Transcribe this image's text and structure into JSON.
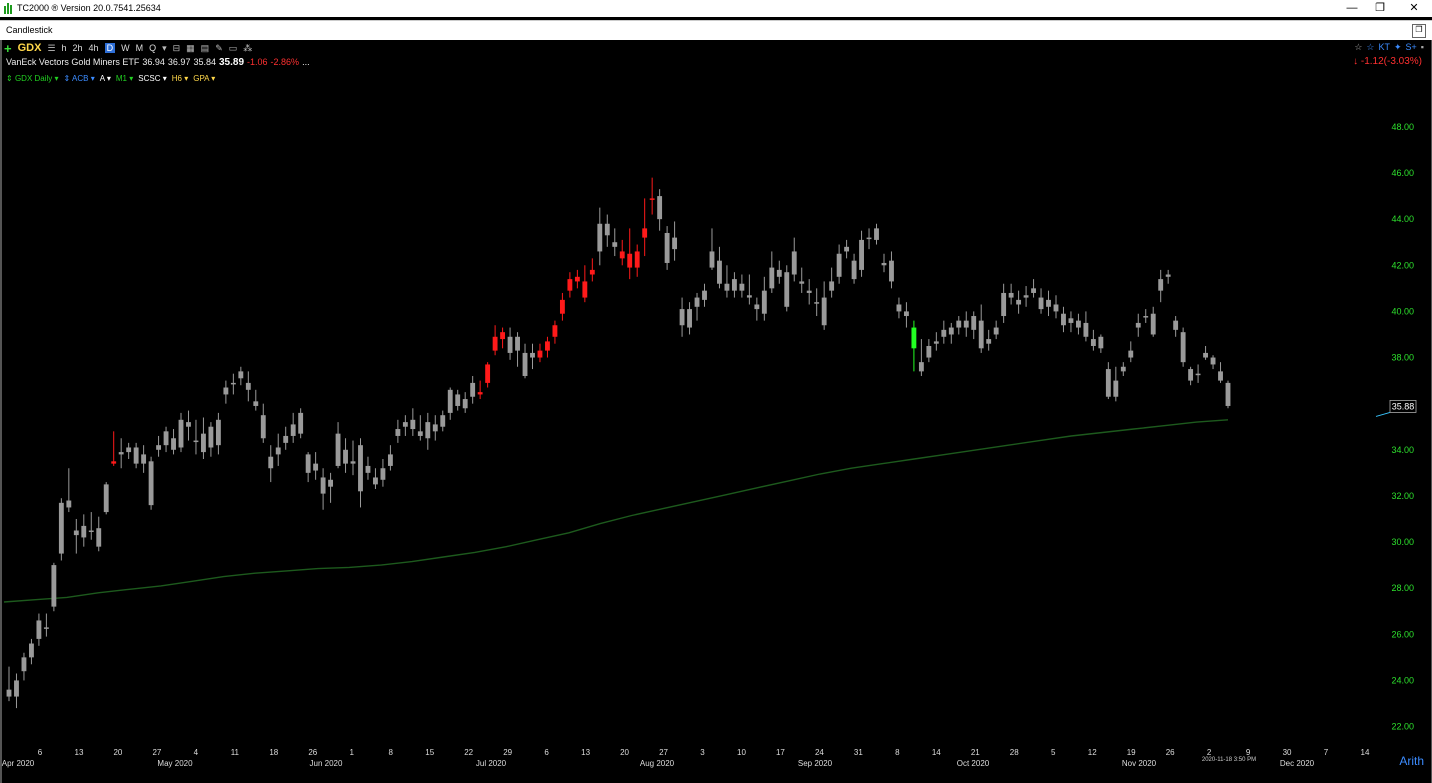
{
  "window": {
    "title": "TC2000 ® Version 20.0.7541.25634",
    "minimize": "—",
    "restore": "❐",
    "close": "✕"
  },
  "chart_window": {
    "title": "Candlestick"
  },
  "toolbar": {
    "symbol": "GDX",
    "timeframes": [
      "h",
      "2h",
      "4h",
      "D",
      "W",
      "M",
      "Q"
    ],
    "active_timeframe": "D"
  },
  "quote": {
    "name": "VanEck Vectors Gold Miners ETF",
    "open": "36.94",
    "high": "36.97",
    "low": "35.84",
    "last": "35.89",
    "change": "-1.06",
    "change_pct": "-2.86%",
    "more": "...",
    "right_change": "-1.12(-3.03%)"
  },
  "indicators": [
    {
      "label": "GDX Daily",
      "color": "#22d022"
    },
    {
      "label": "ACB",
      "color": "#3c8cff"
    },
    {
      "label": "A",
      "color": "#ffffff"
    },
    {
      "label": "M1",
      "color": "#22d022"
    },
    {
      "label": "SCSC",
      "color": "#ffffff"
    },
    {
      "label": "H6",
      "color": "#ffd84a"
    },
    {
      "label": "GPA",
      "color": "#ffd84a"
    }
  ],
  "scale_mode": "Arith",
  "timestamp": "2020-11-18 3:50 PM",
  "chart_data": {
    "type": "candlestick",
    "y_ticks": [
      "48.00",
      "46.00",
      "44.00",
      "42.00",
      "40.00",
      "38.00",
      "36.00",
      "34.00",
      "32.00",
      "30.00",
      "28.00",
      "26.00",
      "24.00",
      "22.00"
    ],
    "ylim": [
      21.2,
      49.6
    ],
    "last_price_label": "35.88",
    "x_day_labels": [
      "6",
      "13",
      "20",
      "27",
      "4",
      "11",
      "18",
      "26",
      "1",
      "8",
      "15",
      "22",
      "29",
      "6",
      "13",
      "20",
      "27",
      "3",
      "10",
      "17",
      "24",
      "31",
      "8",
      "14",
      "21",
      "28",
      "5",
      "12",
      "19",
      "26",
      "2",
      "9",
      "30",
      "7",
      "14"
    ],
    "x_month_labels": [
      "Apr 2020",
      "May 2020",
      "Jun 2020",
      "Jul 2020",
      "Aug 2020",
      "Sep 2020",
      "Oct 2020",
      "Nov 2020",
      "Dec 2020"
    ],
    "colors": {
      "up": "#9a9a9a",
      "down": "#9a9a9a",
      "red": "#ff1a1a",
      "green": "#22ff22",
      "ma": "#1d5a1d",
      "axis_text": "#2de02d"
    },
    "candles": [
      [
        23.6,
        24.6,
        23.1,
        23.3,
        0
      ],
      [
        23.3,
        24.3,
        22.8,
        24.0,
        0
      ],
      [
        24.4,
        25.2,
        24.0,
        25.0,
        0
      ],
      [
        25.0,
        25.8,
        24.7,
        25.6,
        0
      ],
      [
        25.8,
        26.9,
        25.5,
        26.6,
        0
      ],
      [
        26.3,
        26.9,
        25.9,
        26.3,
        0
      ],
      [
        27.2,
        29.1,
        27.0,
        29.0,
        0
      ],
      [
        29.5,
        31.9,
        29.2,
        31.7,
        0
      ],
      [
        31.8,
        33.2,
        31.3,
        31.5,
        0
      ],
      [
        30.5,
        31.0,
        29.5,
        30.3,
        0
      ],
      [
        30.2,
        31.2,
        29.8,
        30.7,
        0
      ],
      [
        30.5,
        31.3,
        30.1,
        30.5,
        0
      ],
      [
        29.8,
        31.1,
        29.6,
        30.6,
        0
      ],
      [
        31.3,
        32.6,
        31.2,
        32.5,
        0
      ],
      [
        33.5,
        34.8,
        33.3,
        33.4,
        1
      ],
      [
        33.8,
        34.5,
        33.2,
        33.9,
        0
      ],
      [
        33.9,
        34.3,
        33.6,
        34.1,
        0
      ],
      [
        34.1,
        34.3,
        33.2,
        33.4,
        0
      ],
      [
        33.4,
        34.2,
        33.0,
        33.8,
        0
      ],
      [
        33.5,
        33.7,
        31.4,
        31.6,
        0
      ],
      [
        34.0,
        34.6,
        33.7,
        34.2,
        0
      ],
      [
        34.2,
        35.0,
        33.9,
        34.8,
        0
      ],
      [
        34.5,
        34.9,
        33.8,
        34.0,
        0
      ],
      [
        34.1,
        35.6,
        33.9,
        35.3,
        0
      ],
      [
        35.2,
        35.7,
        34.4,
        35.0,
        0
      ],
      [
        34.4,
        35.3,
        33.8,
        34.4,
        0
      ],
      [
        34.7,
        35.4,
        33.6,
        33.9,
        0
      ],
      [
        34.1,
        35.2,
        33.7,
        35.0,
        0
      ],
      [
        35.3,
        35.6,
        33.8,
        34.2,
        0
      ],
      [
        36.4,
        37.0,
        36.0,
        36.7,
        0
      ],
      [
        36.9,
        37.3,
        36.4,
        36.9,
        0
      ],
      [
        37.1,
        37.6,
        36.8,
        37.4,
        0
      ],
      [
        36.9,
        37.4,
        36.1,
        36.6,
        0
      ],
      [
        36.1,
        36.6,
        35.7,
        35.9,
        0
      ],
      [
        35.5,
        36.0,
        34.3,
        34.5,
        0
      ],
      [
        33.7,
        34.2,
        32.6,
        33.2,
        0
      ],
      [
        33.8,
        34.7,
        33.3,
        34.1,
        0
      ],
      [
        34.3,
        35.0,
        34.0,
        34.6,
        0
      ],
      [
        34.6,
        35.6,
        34.3,
        35.1,
        0
      ],
      [
        35.6,
        35.8,
        34.5,
        34.7,
        0
      ],
      [
        33.8,
        33.9,
        32.6,
        33.0,
        0
      ],
      [
        33.1,
        33.9,
        32.7,
        33.4,
        0
      ],
      [
        32.8,
        33.2,
        31.4,
        32.1,
        0
      ],
      [
        32.4,
        33.0,
        31.7,
        32.7,
        0
      ],
      [
        34.7,
        35.2,
        33.2,
        33.3,
        0
      ],
      [
        33.4,
        34.5,
        33.0,
        34.0,
        0
      ],
      [
        33.4,
        34.4,
        32.9,
        33.5,
        0
      ],
      [
        34.2,
        34.5,
        31.5,
        32.2,
        0
      ],
      [
        33.0,
        33.7,
        32.7,
        33.3,
        0
      ],
      [
        32.8,
        33.2,
        32.3,
        32.5,
        0
      ],
      [
        32.7,
        33.6,
        32.4,
        33.2,
        0
      ],
      [
        33.3,
        34.2,
        33.1,
        33.8,
        0
      ],
      [
        34.6,
        35.3,
        34.3,
        34.9,
        0
      ],
      [
        35.2,
        35.5,
        34.6,
        35.0,
        0
      ],
      [
        35.3,
        35.8,
        34.6,
        34.9,
        0
      ],
      [
        34.8,
        35.5,
        34.4,
        34.6,
        0
      ],
      [
        35.2,
        35.6,
        34.0,
        34.5,
        0
      ],
      [
        34.8,
        35.5,
        34.4,
        35.1,
        0
      ],
      [
        35.0,
        35.7,
        34.8,
        35.5,
        0
      ],
      [
        35.6,
        36.7,
        35.3,
        36.6,
        0
      ],
      [
        36.4,
        36.6,
        35.7,
        35.9,
        0
      ],
      [
        35.8,
        36.5,
        35.6,
        36.2,
        0
      ],
      [
        36.3,
        37.2,
        36.0,
        36.9,
        0
      ],
      [
        36.4,
        37.0,
        36.2,
        36.5,
        1
      ],
      [
        36.9,
        37.8,
        36.7,
        37.7,
        1
      ],
      [
        38.3,
        39.4,
        38.1,
        38.9,
        1
      ],
      [
        38.8,
        39.3,
        38.4,
        39.1,
        1
      ],
      [
        38.2,
        39.3,
        37.9,
        38.9,
        0
      ],
      [
        38.9,
        39.1,
        37.6,
        38.3,
        0
      ],
      [
        38.2,
        38.6,
        37.1,
        37.2,
        0
      ],
      [
        38.0,
        38.6,
        37.5,
        38.2,
        0
      ],
      [
        38.3,
        38.6,
        37.8,
        38.0,
        1
      ],
      [
        38.3,
        38.9,
        38.0,
        38.7,
        1
      ],
      [
        38.9,
        39.6,
        38.6,
        39.4,
        1
      ],
      [
        39.9,
        40.8,
        39.6,
        40.5,
        1
      ],
      [
        40.9,
        41.7,
        40.6,
        41.4,
        1
      ],
      [
        41.3,
        41.8,
        41.0,
        41.5,
        1
      ],
      [
        41.3,
        42.0,
        40.4,
        40.6,
        1
      ],
      [
        41.8,
        42.3,
        41.3,
        41.6,
        1
      ],
      [
        42.6,
        44.5,
        42.0,
        43.8,
        0
      ],
      [
        43.8,
        44.2,
        42.8,
        43.3,
        0
      ],
      [
        43.0,
        43.6,
        42.4,
        42.8,
        0
      ],
      [
        42.6,
        43.1,
        42.0,
        42.3,
        1
      ],
      [
        42.5,
        43.6,
        41.4,
        41.9,
        1
      ],
      [
        41.9,
        42.9,
        41.5,
        42.6,
        1
      ],
      [
        43.6,
        44.9,
        42.4,
        43.2,
        1
      ],
      [
        44.9,
        45.8,
        44.2,
        44.9,
        1
      ],
      [
        45.0,
        45.3,
        43.5,
        44.0,
        0
      ],
      [
        42.1,
        43.7,
        41.8,
        43.4,
        0
      ],
      [
        43.2,
        43.9,
        42.2,
        42.7,
        0
      ],
      [
        39.4,
        40.6,
        38.9,
        40.1,
        0
      ],
      [
        39.3,
        40.4,
        39.0,
        40.1,
        0
      ],
      [
        40.2,
        40.8,
        39.6,
        40.6,
        0
      ],
      [
        40.5,
        41.2,
        40.2,
        40.9,
        0
      ],
      [
        42.6,
        43.6,
        41.8,
        41.9,
        0
      ],
      [
        42.2,
        42.8,
        41.0,
        41.2,
        0
      ],
      [
        41.2,
        42.0,
        40.6,
        40.9,
        0
      ],
      [
        40.9,
        41.7,
        40.6,
        41.4,
        0
      ],
      [
        40.9,
        41.6,
        40.6,
        41.2,
        0
      ],
      [
        40.7,
        41.6,
        40.3,
        40.6,
        0
      ],
      [
        40.3,
        40.6,
        39.6,
        40.1,
        0
      ],
      [
        39.9,
        41.5,
        39.6,
        40.9,
        0
      ],
      [
        41.0,
        42.6,
        40.8,
        41.9,
        0
      ],
      [
        41.8,
        42.2,
        41.2,
        41.5,
        0
      ],
      [
        40.2,
        42.0,
        40.0,
        41.7,
        0
      ],
      [
        41.6,
        43.2,
        41.3,
        42.6,
        0
      ],
      [
        41.3,
        41.9,
        40.8,
        41.2,
        0
      ],
      [
        40.9,
        41.4,
        40.3,
        40.8,
        0
      ],
      [
        40.4,
        41.0,
        39.8,
        40.4,
        0
      ],
      [
        39.4,
        41.3,
        39.2,
        40.6,
        0
      ],
      [
        40.9,
        41.9,
        40.6,
        41.3,
        0
      ],
      [
        41.5,
        42.9,
        41.2,
        42.5,
        0
      ],
      [
        42.6,
        43.1,
        42.3,
        42.8,
        0
      ],
      [
        42.2,
        42.5,
        41.2,
        41.4,
        0
      ],
      [
        41.8,
        43.5,
        41.5,
        43.1,
        0
      ],
      [
        43.2,
        43.6,
        42.7,
        43.2,
        0
      ],
      [
        43.6,
        43.8,
        42.9,
        43.1,
        0
      ],
      [
        42.1,
        42.5,
        41.7,
        42.0,
        0
      ],
      [
        42.2,
        42.6,
        41.0,
        41.3,
        0
      ],
      [
        40.3,
        40.6,
        39.7,
        40.0,
        0
      ],
      [
        40.0,
        40.4,
        39.3,
        39.8,
        0
      ],
      [
        38.4,
        39.6,
        37.4,
        39.3,
        2
      ],
      [
        37.8,
        38.8,
        37.2,
        37.4,
        0
      ],
      [
        38.0,
        38.8,
        37.8,
        38.5,
        0
      ],
      [
        38.6,
        39.1,
        38.3,
        38.7,
        0
      ],
      [
        38.9,
        39.6,
        38.6,
        39.2,
        0
      ],
      [
        39.0,
        39.5,
        38.6,
        39.3,
        0
      ],
      [
        39.3,
        39.8,
        39.0,
        39.6,
        0
      ],
      [
        39.6,
        40.0,
        38.9,
        39.3,
        0
      ],
      [
        39.2,
        40.0,
        38.8,
        39.8,
        0
      ],
      [
        39.6,
        40.3,
        38.2,
        38.4,
        0
      ],
      [
        38.6,
        39.2,
        38.3,
        38.8,
        0
      ],
      [
        39.0,
        39.6,
        38.8,
        39.3,
        0
      ],
      [
        39.8,
        41.2,
        39.5,
        40.8,
        0
      ],
      [
        40.8,
        41.2,
        40.3,
        40.6,
        0
      ],
      [
        40.5,
        40.9,
        39.9,
        40.3,
        0
      ],
      [
        40.6,
        41.1,
        40.2,
        40.7,
        0
      ],
      [
        41.0,
        41.4,
        40.6,
        40.8,
        0
      ],
      [
        40.6,
        41.0,
        39.9,
        40.1,
        0
      ],
      [
        40.5,
        40.9,
        39.8,
        40.2,
        0
      ],
      [
        40.3,
        40.7,
        39.7,
        40.0,
        0
      ],
      [
        39.9,
        40.2,
        39.1,
        39.4,
        0
      ],
      [
        39.5,
        40.0,
        39.1,
        39.7,
        0
      ],
      [
        39.6,
        39.9,
        39.0,
        39.3,
        0
      ],
      [
        39.5,
        40.0,
        38.7,
        38.9,
        0
      ],
      [
        38.8,
        39.2,
        38.3,
        38.5,
        0
      ],
      [
        38.9,
        39.0,
        38.2,
        38.4,
        0
      ],
      [
        37.5,
        37.8,
        36.2,
        36.3,
        0
      ],
      [
        37.0,
        37.6,
        36.1,
        36.3,
        0
      ],
      [
        37.6,
        37.8,
        37.2,
        37.4,
        0
      ],
      [
        38.3,
        38.7,
        37.8,
        38.0,
        0
      ],
      [
        39.3,
        39.9,
        38.9,
        39.5,
        0
      ],
      [
        39.8,
        40.1,
        39.5,
        39.8,
        0
      ],
      [
        39.9,
        40.2,
        38.9,
        39.0,
        0
      ],
      [
        40.9,
        41.8,
        40.4,
        41.4,
        0
      ],
      [
        41.5,
        41.8,
        41.2,
        41.6,
        0
      ],
      [
        39.6,
        39.8,
        38.9,
        39.2,
        0
      ],
      [
        39.1,
        39.3,
        37.6,
        37.8,
        0
      ],
      [
        37.5,
        37.6,
        36.8,
        37.0,
        0
      ],
      [
        37.3,
        37.7,
        36.9,
        37.3,
        0
      ],
      [
        38.2,
        38.5,
        37.9,
        38.0,
        0
      ],
      [
        38.0,
        38.1,
        37.5,
        37.7,
        0
      ],
      [
        37.4,
        37.8,
        36.9,
        37.0,
        0
      ],
      [
        36.9,
        37.0,
        35.8,
        35.9,
        0
      ]
    ],
    "ma": [
      27.4,
      27.5,
      27.6,
      27.8,
      27.95,
      28.1,
      28.3,
      28.5,
      28.65,
      28.75,
      28.85,
      28.9,
      29.0,
      29.15,
      29.35,
      29.55,
      29.8,
      30.1,
      30.4,
      30.8,
      31.15,
      31.45,
      31.75,
      32.05,
      32.35,
      32.65,
      32.95,
      33.2,
      33.4,
      33.6,
      33.8,
      34.0,
      34.2,
      34.4,
      34.6,
      34.75,
      34.9,
      35.05,
      35.2,
      35.3
    ]
  }
}
